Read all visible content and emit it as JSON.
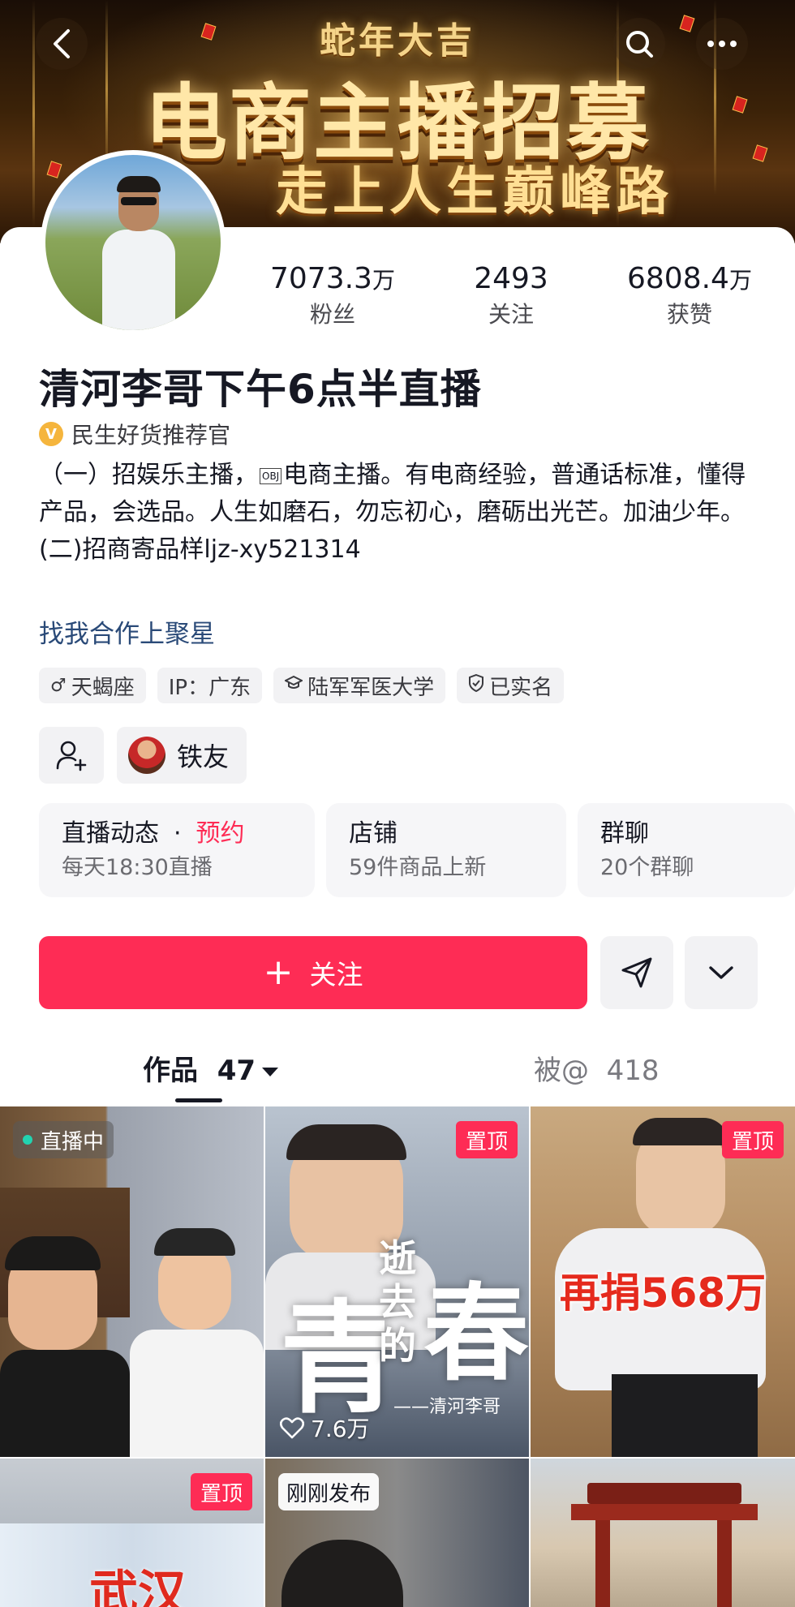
{
  "banner": {
    "small_title": "蛇年大吉",
    "big_title": "电商主播招募",
    "sub_title": "走上人生巅峰路"
  },
  "profile": {
    "stats": [
      {
        "num": "7073.3",
        "unit": "万",
        "label": "粉丝"
      },
      {
        "num": "2493",
        "unit": "",
        "label": "关注"
      },
      {
        "num": "6808.4",
        "unit": "万",
        "label": "获赞"
      }
    ],
    "name": "清河李哥下午6点半直播",
    "verified_badge": "V",
    "verified_text": "民生好货推荐官",
    "bio_line1a": "（一）招娱乐主播，",
    "bio_obj": "OBJ",
    "bio_line1b": "电商主播。有电商经验，普通话标准，懂得产品，会选品。人生如磨石，勿忘初心，磨砺出光芒。加油少年。",
    "bio_line2": "(二)招商寄品样ljz-xy521314",
    "bio_link": "找我合作上聚星",
    "tags": [
      {
        "icon": "male-icon",
        "glyph": "♂",
        "text": "天蝎座"
      },
      {
        "icon": "",
        "glyph": "",
        "text": "IP：广东"
      },
      {
        "icon": "graduation-cap-icon",
        "glyph": "🎓",
        "text": "陆军军医大学"
      },
      {
        "icon": "shield-check-icon",
        "glyph": "✓",
        "text": "已实名"
      }
    ],
    "fan_group": "铁友"
  },
  "cards": [
    {
      "title": "直播动态",
      "dot": "·",
      "highlight": "预约",
      "sub": "每天18:30直播"
    },
    {
      "title": "店铺",
      "sub": "59件商品上新"
    },
    {
      "title": "群聊",
      "sub": "20个群聊"
    }
  ],
  "actions": {
    "follow_plus": "+",
    "follow_label": "关注"
  },
  "tabs": {
    "works_label": "作品",
    "works_count": "47",
    "mentions_label": "被@",
    "mentions_count": "418"
  },
  "videos": [
    {
      "badge": "直播中",
      "badge_type": "live"
    },
    {
      "badge": "置顶",
      "badge_type": "pin",
      "likes": "7.6万",
      "overlay_big": "青",
      "overlay_mid": "逝去的",
      "overlay_right": "春",
      "signature": "——清河李哥"
    },
    {
      "badge": "置顶",
      "badge_type": "pin",
      "overlay": "再捐568万"
    },
    {
      "badge": "置顶",
      "badge_type": "pin",
      "overlay": "武汉"
    },
    {
      "badge": "刚刚发布",
      "badge_type": "new"
    },
    {
      "badge": "",
      "badge_type": "none"
    }
  ],
  "colors": {
    "accent": "#fe2c55",
    "verified": "#f5b53d",
    "link": "#2a4a78"
  }
}
